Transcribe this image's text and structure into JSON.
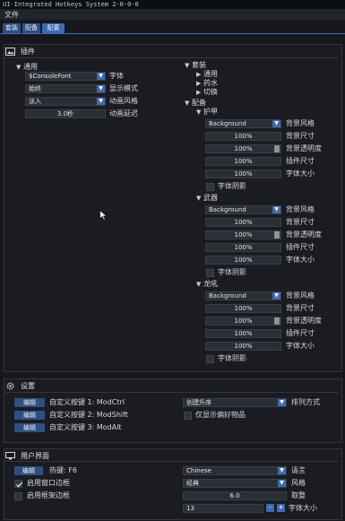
{
  "window": {
    "title": "UI-Integrated Hotkeys System 2-0-0-0"
  },
  "menu": {
    "file": "文件"
  },
  "tabs": [
    "套装",
    "配备",
    "配置"
  ],
  "plugins": {
    "title": "插件",
    "general": {
      "label": "通用",
      "font_value": "$ConsoleFont",
      "font_label": "字体",
      "display_value": "始终",
      "display_label": "显示模式",
      "anim_value": "淡入",
      "anim_label": "动画风格",
      "delay_value": "3.0秒",
      "delay_label": "动画延迟"
    },
    "sets": {
      "label": "套装",
      "children": [
        "通用",
        "药水",
        "切换"
      ]
    },
    "equip": {
      "label": "配备",
      "groups": [
        {
          "name": "护甲"
        },
        {
          "name": "武器"
        },
        {
          "name": "龙吼"
        }
      ],
      "style_value": "Background",
      "style_label": "背景风格",
      "size_value": "100%",
      "size_label": "背景尺寸",
      "opacity_value": "100%",
      "opacity_label": "背景透明度",
      "plugin_size_value": "100%",
      "plugin_size_label": "插件尺寸",
      "font_size_value": "100%",
      "font_size_label": "字体大小",
      "shadow_label": "字体阴影"
    }
  },
  "settings": {
    "title": "设置",
    "edit_label": "编辑",
    "hotkeys": [
      "自定义按键 1: ModCtrl",
      "自定义按键 2: ModShift",
      "自定义按键 3: ModAlt"
    ],
    "sort_value": "创建升序",
    "sort_label": "排列方式",
    "favorites_label": "仅显示偏好物品"
  },
  "ui": {
    "title": "用户界面",
    "edit_label": "编辑",
    "hotkey_label": "热键: F6",
    "window_border_label": "启用窗口边框",
    "frame_border_label": "启用框架边框",
    "language_value": "Chinese",
    "language_label": "语言",
    "style_value": "经典",
    "style_label": "风格",
    "adjust_value": "6.0",
    "adjust_label": "取整",
    "font_size_value": "13",
    "font_size_label": "字体大小",
    "minus": "-",
    "plus": "+"
  },
  "colors": {
    "accent": "#3d6bb4",
    "button": "#2f4f82",
    "bg": "#16181d"
  }
}
